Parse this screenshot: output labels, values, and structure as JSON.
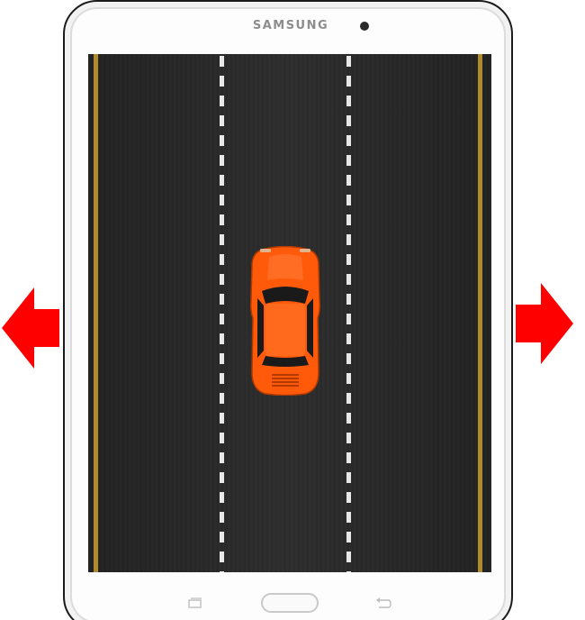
{
  "device": {
    "brand": "SAMSUNG"
  },
  "game": {
    "car_color": "#ff5a0a",
    "road_color": "#2a2a2a",
    "edge_line_color": "#b08a2e",
    "lane_marking_color": "#e8e8e8",
    "lanes": 3,
    "car_lane": 2
  },
  "controls": {
    "left_arrow_icon": "arrow-left-icon",
    "right_arrow_icon": "arrow-right-icon",
    "arrow_color": "#ff0000"
  },
  "nav": {
    "recent_icon": "recent-apps-icon",
    "home_icon": "home-button",
    "back_icon": "back-icon"
  }
}
